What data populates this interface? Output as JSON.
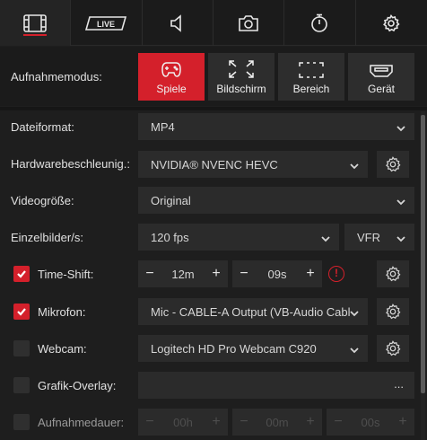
{
  "tabs": [
    {
      "icon": "film-icon",
      "active": true
    },
    {
      "icon": "live-icon",
      "label": "LIVE"
    },
    {
      "icon": "speaker-icon"
    },
    {
      "icon": "camera-icon"
    },
    {
      "icon": "timer-icon"
    },
    {
      "icon": "gear-icon"
    }
  ],
  "capture_mode": {
    "label": "Aufnahmemodus:",
    "options": [
      {
        "label": "Spiele",
        "icon": "gamepad-icon",
        "active": true
      },
      {
        "label": "Bildschirm",
        "icon": "fullscreen-icon"
      },
      {
        "label": "Bereich",
        "icon": "region-icon"
      },
      {
        "label": "Gerät",
        "icon": "hdmi-icon"
      }
    ]
  },
  "settings": {
    "file_format": {
      "label": "Dateiformat:",
      "value": "MP4"
    },
    "hw_accel": {
      "label": "Hardwarebeschleunig.:",
      "value": "NVIDIA® NVENC HEVC"
    },
    "video_size": {
      "label": "Videogröße:",
      "value": "Original"
    },
    "fps": {
      "label": "Einzelbilder/s:",
      "value": "120 fps",
      "mode": "VFR"
    },
    "timeshift": {
      "label": "Time-Shift:",
      "checked": true,
      "minutes": "12m",
      "seconds": "09s",
      "warning": "!"
    },
    "microphone": {
      "label": "Mikrofon:",
      "checked": true,
      "value": "Mic - CABLE-A Output (VB-Audio Cabl…"
    },
    "webcam": {
      "label": "Webcam:",
      "checked": false,
      "value": "Logitech HD Pro Webcam C920"
    },
    "overlay": {
      "label": "Grafik-Overlay:",
      "checked": false,
      "value": "..."
    },
    "duration": {
      "label": "Aufnahmedauer:",
      "checked": false,
      "hours": "00h",
      "minutes": "00m",
      "seconds": "00s"
    }
  },
  "stepper": {
    "minus": "−",
    "plus": "+"
  },
  "colors": {
    "accent": "#d4202b",
    "background": "#1e1e1e",
    "field": "#2b2b2b"
  }
}
